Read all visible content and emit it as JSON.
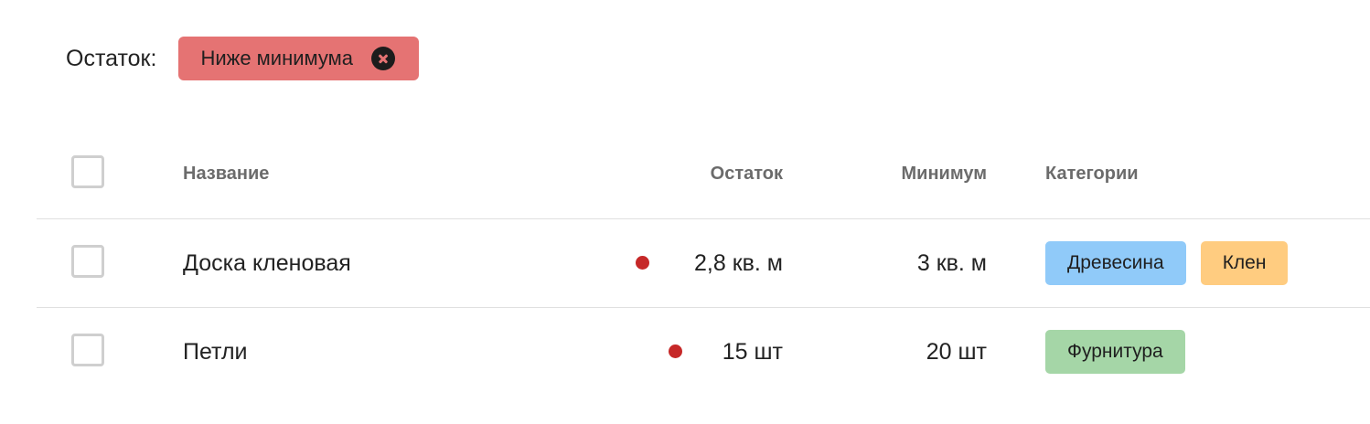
{
  "filter": {
    "label": "Остаток:",
    "chip_label": "Ниже минимума",
    "chip_color": "#e57373"
  },
  "table": {
    "headers": {
      "name": "Название",
      "stock": "Остаток",
      "minimum": "Минимум",
      "categories": "Категории"
    },
    "rows": [
      {
        "name": "Доска кленовая",
        "stock": "2,8 кв. м",
        "minimum": "3 кв. м",
        "below_min_indicator_color": "#c62828",
        "categories": [
          {
            "label": "Древесина",
            "color": "#90caf9"
          },
          {
            "label": "Клен",
            "color": "#ffcc80"
          }
        ]
      },
      {
        "name": "Петли",
        "stock": "15 шт",
        "minimum": "20 шт",
        "below_min_indicator_color": "#c62828",
        "categories": [
          {
            "label": "Фурнитура",
            "color": "#a5d6a7"
          }
        ]
      }
    ]
  }
}
